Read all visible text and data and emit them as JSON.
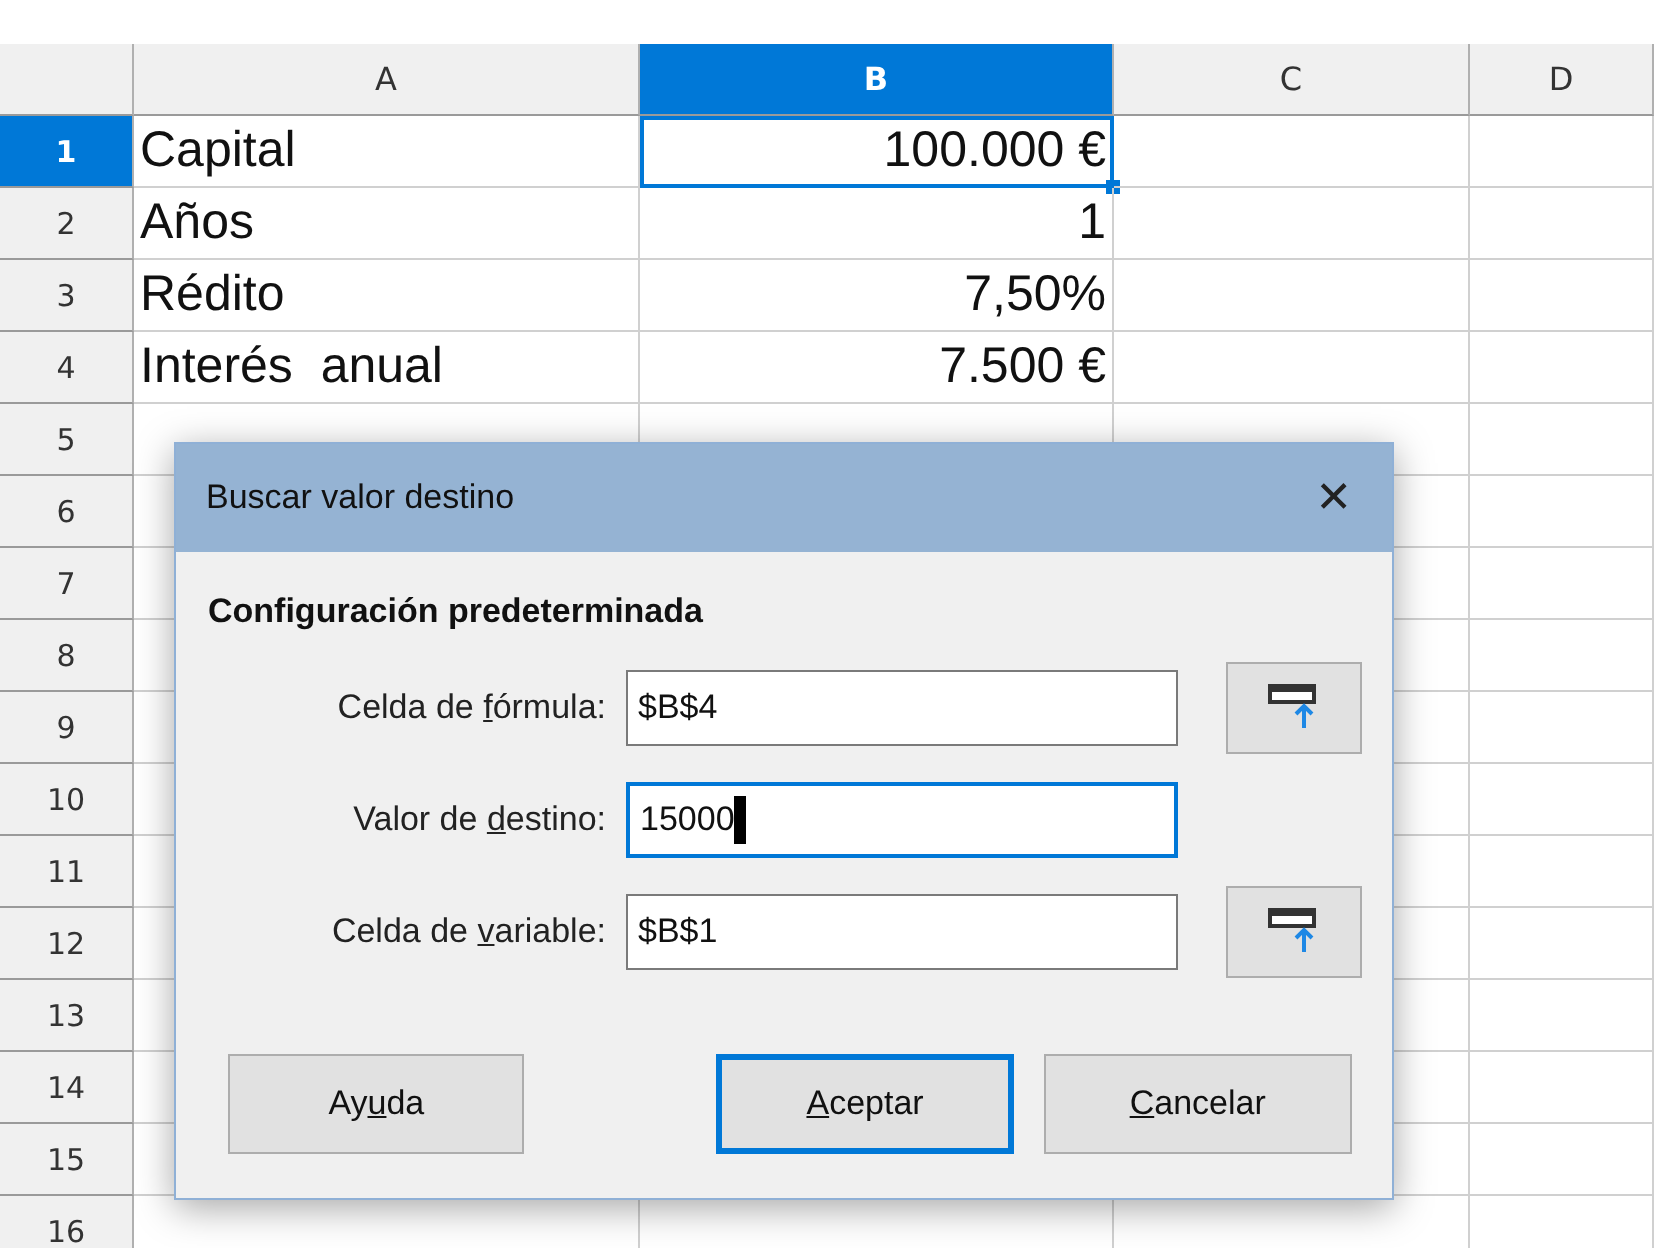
{
  "sheet": {
    "columns": [
      {
        "label": "A",
        "selected": false
      },
      {
        "label": "B",
        "selected": true
      },
      {
        "label": "C",
        "selected": false
      },
      {
        "label": "D",
        "selected": false
      }
    ],
    "rows": [
      {
        "number": "1",
        "selected": true,
        "cells": [
          "Capital",
          "100.000 €"
        ]
      },
      {
        "number": "2",
        "selected": false,
        "cells": [
          "Años",
          "1"
        ]
      },
      {
        "number": "3",
        "selected": false,
        "cells": [
          "Rédito",
          "7,50%"
        ]
      },
      {
        "number": "4",
        "selected": false,
        "cells": [
          "Interés  anual",
          "7.500 €"
        ]
      },
      {
        "number": "5",
        "selected": false,
        "cells": []
      },
      {
        "number": "6",
        "selected": false,
        "cells": []
      },
      {
        "number": "7",
        "selected": false,
        "cells": []
      },
      {
        "number": "8",
        "selected": false,
        "cells": []
      },
      {
        "number": "9",
        "selected": false,
        "cells": []
      },
      {
        "number": "10",
        "selected": false,
        "cells": []
      },
      {
        "number": "11",
        "selected": false,
        "cells": []
      },
      {
        "number": "12",
        "selected": false,
        "cells": []
      },
      {
        "number": "13",
        "selected": false,
        "cells": []
      },
      {
        "number": "14",
        "selected": false,
        "cells": []
      },
      {
        "number": "15",
        "selected": false,
        "cells": []
      },
      {
        "number": "16",
        "selected": false,
        "cells": []
      }
    ]
  },
  "dialog": {
    "title": "Buscar valor destino",
    "close": "✕",
    "section": "Configuración predeterminada",
    "fields": [
      {
        "label_parts": [
          {
            "text": "Celda de ",
            "underline": false
          },
          {
            "text": "f",
            "underline": true
          },
          {
            "text": "órmula:",
            "underline": false
          }
        ],
        "value": "$B$4",
        "focused": false,
        "picker": true
      },
      {
        "label_parts": [
          {
            "text": "Valor de ",
            "underline": false
          },
          {
            "text": "d",
            "underline": true
          },
          {
            "text": "estino:",
            "underline": false
          }
        ],
        "value": "15000",
        "focused": true,
        "picker": false
      },
      {
        "label_parts": [
          {
            "text": "Celda de ",
            "underline": false
          },
          {
            "text": "v",
            "underline": true
          },
          {
            "text": "ariable:",
            "underline": false
          }
        ],
        "value": "$B$1",
        "focused": false,
        "picker": true
      }
    ],
    "buttons": [
      {
        "label_parts": [
          {
            "text": "Ay",
            "underline": false
          },
          {
            "text": "u",
            "underline": true
          },
          {
            "text": "da",
            "underline": false
          }
        ],
        "default": false,
        "kind": "help"
      },
      {
        "label_parts": [
          {
            "text": "A",
            "underline": true
          },
          {
            "text": "ceptar",
            "underline": false
          }
        ],
        "default": true,
        "kind": "action"
      },
      {
        "label_parts": [
          {
            "text": "C",
            "underline": true
          },
          {
            "text": "ancelar",
            "underline": false
          }
        ],
        "default": false,
        "kind": "action"
      }
    ]
  }
}
